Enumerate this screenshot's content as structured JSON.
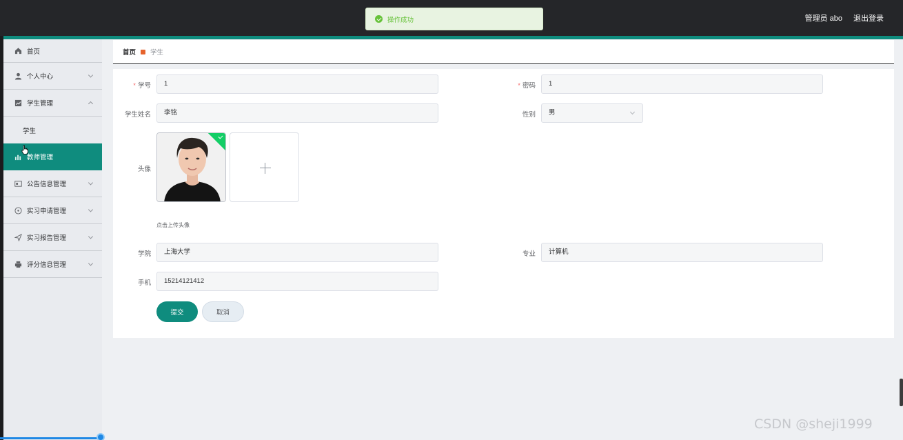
{
  "topbar": {
    "user_label": "管理员 abo",
    "logout_label": "退出登录"
  },
  "toast": {
    "message": "操作成功",
    "icon": "check-circle-icon",
    "color": "#67c23a"
  },
  "colors": {
    "accent": "#0f8c7e",
    "topbar": "#252629",
    "required": "#f56c6c"
  },
  "sidebar": {
    "items": [
      {
        "label": "首页",
        "icon": "home-icon"
      },
      {
        "label": "个人中心",
        "icon": "user-icon"
      },
      {
        "label": "学生管理",
        "icon": "chart-icon",
        "expanded": true
      },
      {
        "label": "学生",
        "icon": ""
      },
      {
        "label": "教师管理",
        "icon": "bar-chart-icon",
        "active": true
      },
      {
        "label": "公告信息管理",
        "icon": "card-icon"
      },
      {
        "label": "实习申请管理",
        "icon": "compass-icon"
      },
      {
        "label": "实习报告管理",
        "icon": "send-icon"
      },
      {
        "label": "评分信息管理",
        "icon": "printer-icon"
      }
    ]
  },
  "breadcrumb": {
    "home": "首页",
    "current": "学生"
  },
  "form": {
    "student_id": {
      "label": "学号",
      "value": "1"
    },
    "password": {
      "label": "密码",
      "value": "1"
    },
    "name": {
      "label": "学生姓名",
      "value": "李铭"
    },
    "gender": {
      "label": "性别",
      "value": "男"
    },
    "avatar": {
      "label": "头像",
      "tip": "点击上传头像"
    },
    "college": {
      "label": "学院",
      "value": "上海大学"
    },
    "major": {
      "label": "专业",
      "value": "计算机"
    },
    "phone": {
      "label": "手机",
      "value": "15214121412"
    },
    "submit_label": "提交",
    "cancel_label": "取消"
  },
  "watermark": "CSDN @sheji1999"
}
